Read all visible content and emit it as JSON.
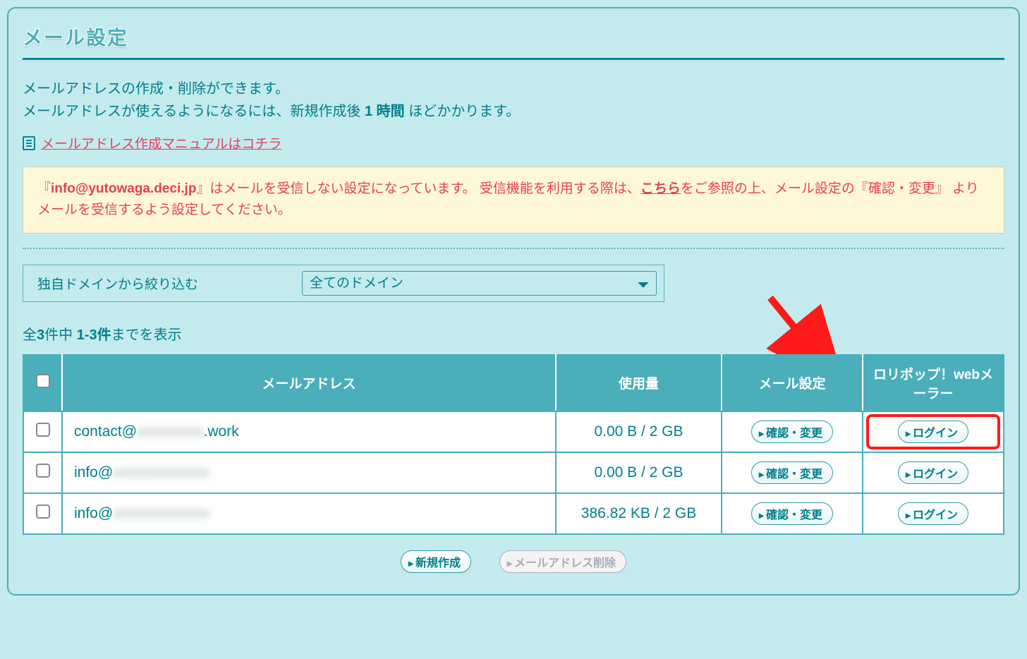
{
  "page": {
    "title": "メール設定",
    "desc1": "メールアドレスの作成・削除ができます。",
    "desc2a": "メールアドレスが使えるようになるには、新規作成後 ",
    "desc2b": "1 時間",
    "desc2c": " ほどかかります。",
    "manual_link": "メールアドレス作成マニュアルはコチラ"
  },
  "notice": {
    "t1": "『",
    "email": "info@yutowaga.deci.jp",
    "t2": "』はメールを受信しない設定になっています。 受信機能を利用する際は、",
    "link": "こちら",
    "t3": "をご参照の上、メール設定の『確認・変更』 よりメールを受信するよう設定してください。"
  },
  "filter": {
    "label": "独自ドメインから絞り込む",
    "selected": "全てのドメイン"
  },
  "count": {
    "a": "全",
    "b": "3",
    "c": "件中 ",
    "d": "1-3件",
    "e": "までを表示"
  },
  "headers": {
    "addr": "メールアドレス",
    "usage": "使用量",
    "settings": "メール設定",
    "webmailer": "ロリポップ！webメーラー"
  },
  "rows": [
    {
      "addr_pre": "contact@",
      "addr_blur": "xxxxxxxxx",
      "addr_post": ".work",
      "usage": "0.00 B / 2 GB"
    },
    {
      "addr_pre": "info@",
      "addr_blur": "xxxxxxxxxxxxx",
      "addr_post": "",
      "usage": "0.00 B / 2 GB"
    },
    {
      "addr_pre": "info@",
      "addr_blur": "xxxxxxxxxxxxx",
      "addr_post": "",
      "usage": "386.82 KB / 2 GB"
    }
  ],
  "buttons": {
    "confirm": "確認・変更",
    "login": "ログイン",
    "create": "新規作成",
    "delete": "メールアドレス削除"
  }
}
